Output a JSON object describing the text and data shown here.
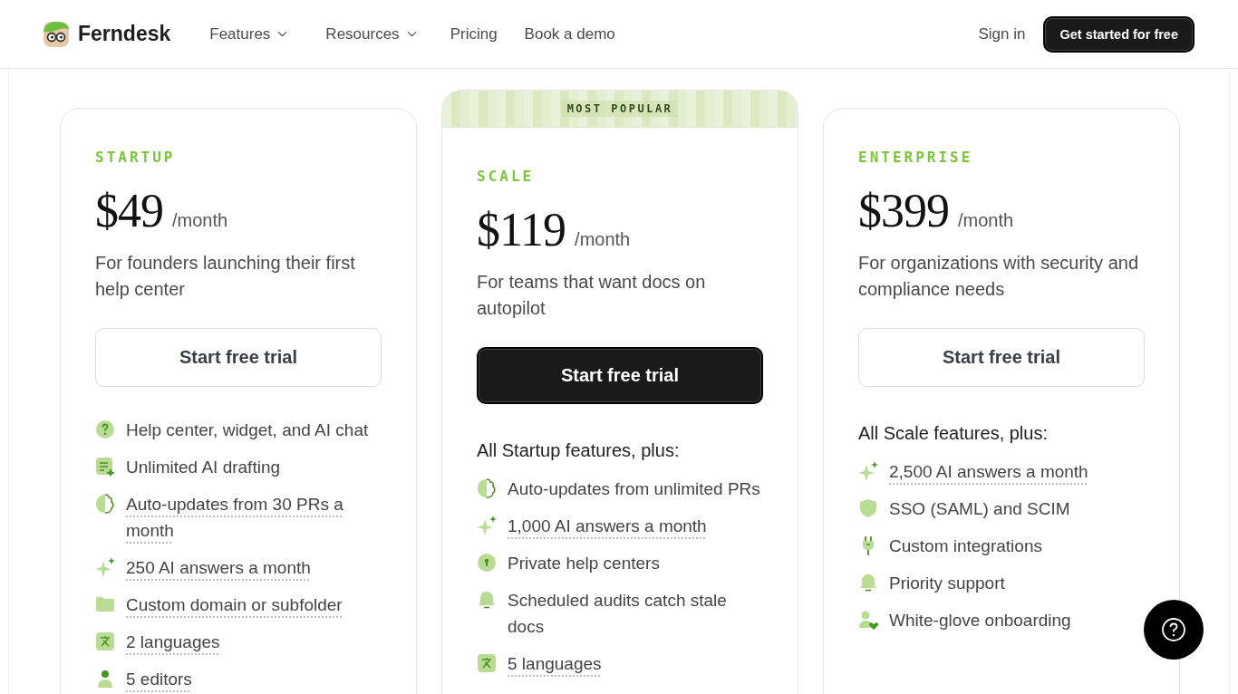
{
  "header": {
    "brand": "Ferndesk",
    "nav": [
      {
        "label": "Features",
        "dropdown": true
      },
      {
        "label": "Resources",
        "dropdown": true
      },
      {
        "label": "Pricing",
        "dropdown": false
      },
      {
        "label": "Book a demo",
        "dropdown": false
      }
    ],
    "sign_in": "Sign in",
    "cta": "Get started for free"
  },
  "plans": [
    {
      "name": "STARTUP",
      "popular": false,
      "price": "$49",
      "period": "/month",
      "description": "For founders launching their first help center",
      "button": "Start free trial",
      "features": [
        {
          "kind": "question",
          "text": "Help center, widget, and AI chat",
          "underlined": false
        },
        {
          "kind": "draft",
          "text": "Unlimited AI drafting",
          "underlined": false
        },
        {
          "kind": "brain",
          "text": "Auto-updates from 30 PRs a month",
          "underlined": true
        },
        {
          "kind": "sparkle",
          "text": "250 AI answers a month",
          "underlined": true
        },
        {
          "kind": "folder",
          "text": "Custom domain or subfolder",
          "underlined": true
        },
        {
          "kind": "translate",
          "text": "2 languages",
          "underlined": true
        },
        {
          "kind": "person",
          "text": "5 editors",
          "underlined": true
        }
      ]
    },
    {
      "name": "SCALE",
      "popular": true,
      "badge": "MOST POPULAR",
      "price": "$119",
      "period": "/month",
      "description": "For teams that want docs on autopilot",
      "button": "Start free trial",
      "heading": "All Startup features, plus:",
      "features": [
        {
          "kind": "brain",
          "text": "Auto-updates from unlimited PRs",
          "underlined": false
        },
        {
          "kind": "sparkle",
          "text": "1,000 AI answers a month",
          "underlined": true
        },
        {
          "kind": "lock",
          "text": "Private help centers",
          "underlined": false
        },
        {
          "kind": "bell",
          "text": "Scheduled audits catch stale docs",
          "underlined": false
        },
        {
          "kind": "translate",
          "text": "5 languages",
          "underlined": true
        }
      ]
    },
    {
      "name": "ENTERPRISE",
      "popular": false,
      "price": "$399",
      "period": "/month",
      "description": "For organizations with security and compliance needs",
      "button": "Start free trial",
      "heading": "All Scale features, plus:",
      "features": [
        {
          "kind": "sparkle",
          "text": "2,500 AI answers a month",
          "underlined": true
        },
        {
          "kind": "shield",
          "text": "SSO (SAML) and SCIM",
          "underlined": false
        },
        {
          "kind": "plug",
          "text": "Custom integrations",
          "underlined": false
        },
        {
          "kind": "bell",
          "text": "Priority support",
          "underlined": false
        },
        {
          "kind": "person-heart",
          "text": "White-glove onboarding",
          "underlined": false
        }
      ]
    }
  ]
}
